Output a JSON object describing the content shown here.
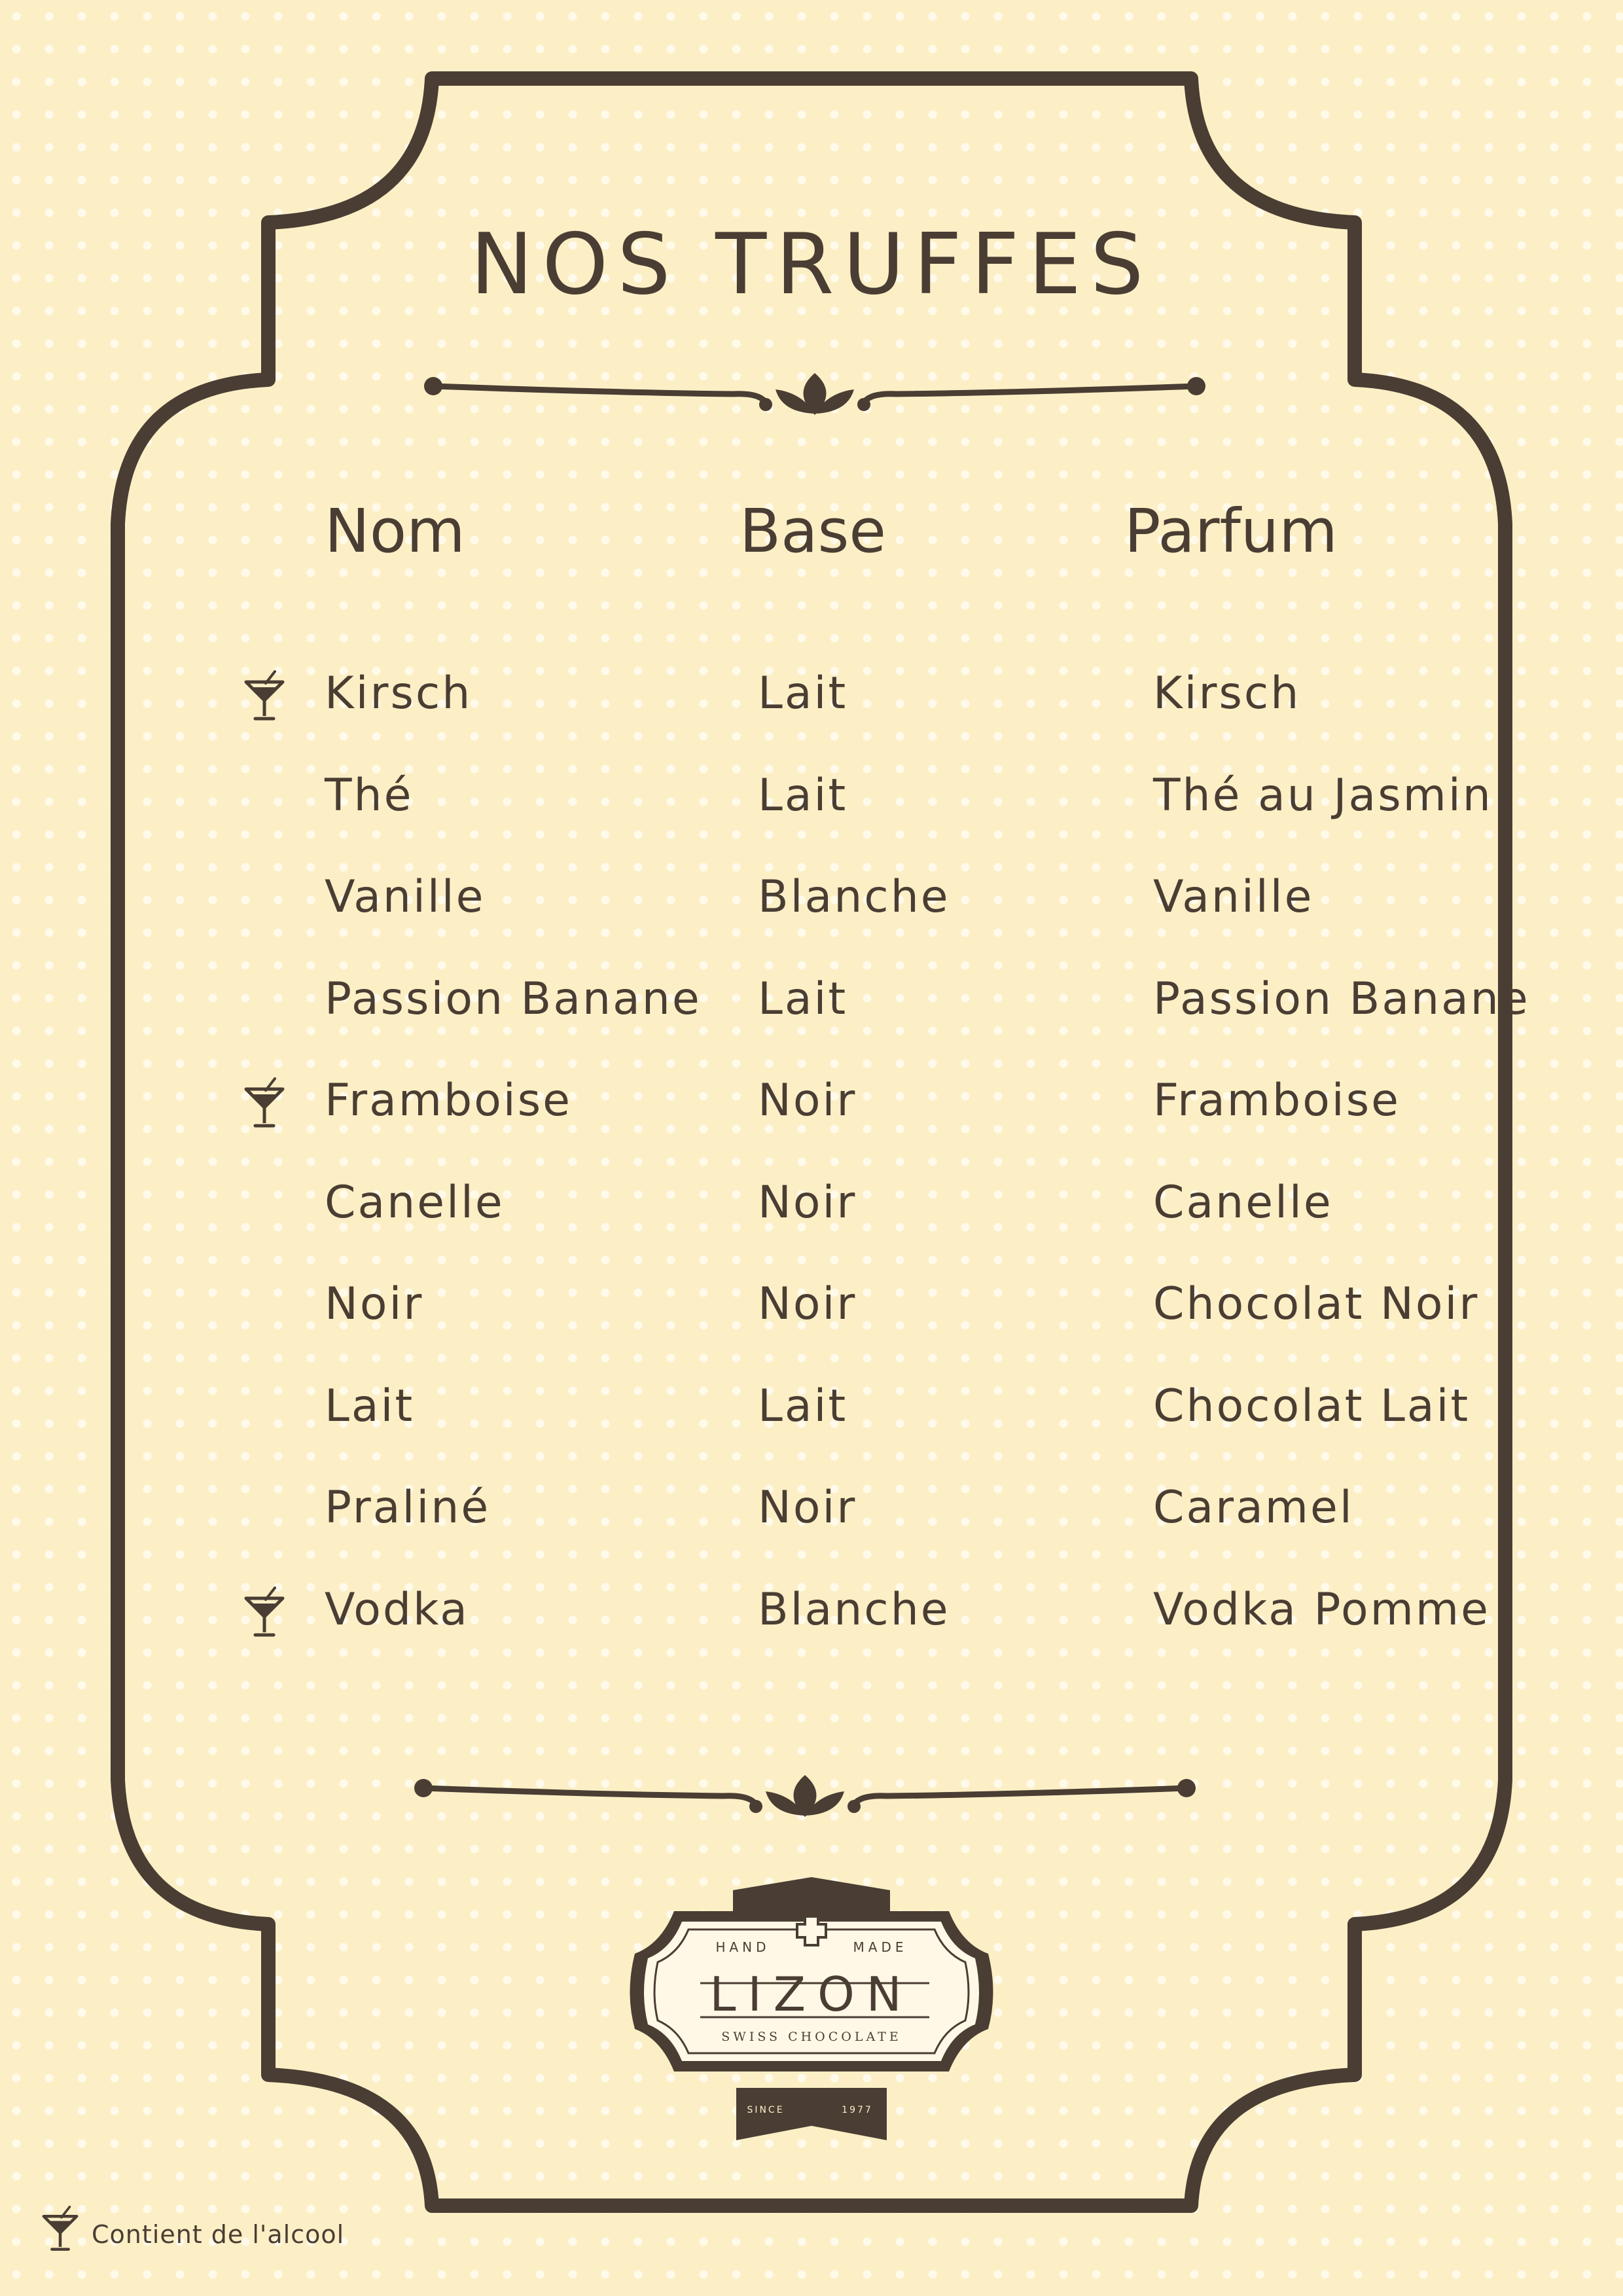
{
  "title": "NOS TRUFFES",
  "colors": {
    "ink": "#4a3d33",
    "background": "#fcefc6",
    "dots": "#fffaea"
  },
  "columns": {
    "name": "Nom",
    "base": "Base",
    "flavor": "Parfum"
  },
  "rows": [
    {
      "name": "Kirsch",
      "base": "Lait",
      "flavor": "Kirsch",
      "alcohol": true
    },
    {
      "name": "Thé",
      "base": "Lait",
      "flavor": "Thé au Jasmin",
      "alcohol": false
    },
    {
      "name": "Vanille",
      "base": "Blanche",
      "flavor": "Vanille",
      "alcohol": false
    },
    {
      "name": "Passion Banane",
      "base": "Lait",
      "flavor": "Passion Banane",
      "alcohol": false
    },
    {
      "name": "Framboise",
      "base": "Noir",
      "flavor": "Framboise",
      "alcohol": true
    },
    {
      "name": "Canelle",
      "base": "Noir",
      "flavor": "Canelle",
      "alcohol": false
    },
    {
      "name": "Noir",
      "base": "Noir",
      "flavor": "Chocolat Noir",
      "alcohol": false
    },
    {
      "name": "Lait",
      "base": "Lait",
      "flavor": "Chocolat Lait",
      "alcohol": false
    },
    {
      "name": "Praliné",
      "base": "Noir",
      "flavor": "Caramel",
      "alcohol": false
    },
    {
      "name": "Vodka",
      "base": "Blanche",
      "flavor": "Vodka Pomme",
      "alcohol": true
    }
  ],
  "logo": {
    "top_left": "HAND",
    "top_right": "MADE",
    "brand": "LIZON",
    "tagline": "SWISS CHOCOLATE",
    "since_label": "SINCE",
    "since_year": "1977"
  },
  "legend": {
    "icon": "cocktail-icon",
    "text": "Contient de l'alcool"
  }
}
